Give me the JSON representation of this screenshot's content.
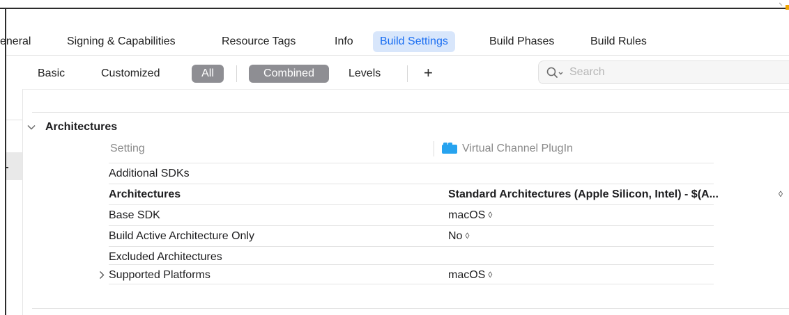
{
  "tabs": [
    {
      "label": "eneral",
      "active": false
    },
    {
      "label": "Signing & Capabilities",
      "active": false
    },
    {
      "label": "Resource Tags",
      "active": false
    },
    {
      "label": "Info",
      "active": false
    },
    {
      "label": "Build Settings",
      "active": true
    },
    {
      "label": "Build Phases",
      "active": false
    },
    {
      "label": "Build Rules",
      "active": false
    }
  ],
  "filters": {
    "basic": "Basic",
    "customized": "Customized",
    "all": "All",
    "combined": "Combined",
    "levels": "Levels",
    "add": "+"
  },
  "search": {
    "placeholder": "Search",
    "value": ""
  },
  "section": {
    "title": "Architectures",
    "col_setting": "Setting",
    "col_target": "Virtual Channel PlugIn",
    "rows": [
      {
        "label": "Additional SDKs",
        "value": "",
        "bold": false,
        "stepper": false
      },
      {
        "label": "Architectures",
        "value": "Standard Architectures (Apple Silicon, Intel)  -  $(A...",
        "bold": true,
        "stepper": true
      },
      {
        "label": "Base SDK",
        "value": "macOS",
        "bold": false,
        "stepper": true
      },
      {
        "label": "Build Active Architecture Only",
        "value": "No",
        "bold": false,
        "stepper": true
      },
      {
        "label": "Excluded Architectures",
        "value": "",
        "bold": false,
        "stepper": false
      },
      {
        "label": "Supported Platforms",
        "value": "macOS",
        "bold": false,
        "stepper": true,
        "expandable": true
      }
    ]
  },
  "colors": {
    "accent": "#1a6ef2",
    "active_tab_bg": "#d8e6fb",
    "pill_bg": "#8e8e93",
    "target_icon": "#27a3ef"
  }
}
